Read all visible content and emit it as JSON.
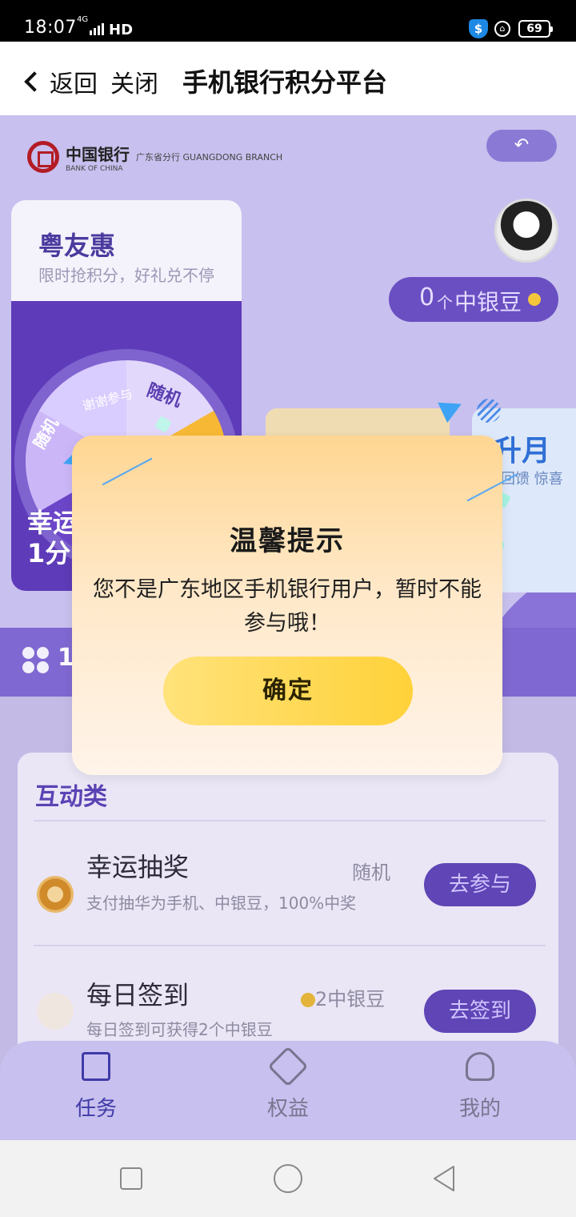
{
  "status_bar": {
    "time": "18:07",
    "network": "4G",
    "hd": "HD",
    "battery": "69"
  },
  "nav": {
    "back_label": "返回",
    "close_label": "关闭",
    "title": "手机银行积分平台"
  },
  "bank_logo": {
    "name_cn": "中国银行",
    "name_en": "BANK OF CHINA",
    "branch": "广东省分行 GUANGDONG BRANCH"
  },
  "promo_card": {
    "title": "粤友惠",
    "subtitle": "限时抢积分，好礼兑不停",
    "wheel_labels": [
      "随机",
      "谢谢参与",
      "随机"
    ],
    "bottom_text": "幸运\n1分"
  },
  "promo_card_right": {
    "title": "升月",
    "subtitle": "回馈 惊喜"
  },
  "beans": {
    "count": "0",
    "unit": "个",
    "label": "中银豆"
  },
  "strip": {
    "text": "1"
  },
  "tasks": {
    "section_title": "互动类",
    "items": [
      {
        "name": "幸运抽奖",
        "desc": "支付抽华为手机、中银豆，100%中奖",
        "reward": "随机",
        "button": "去参与"
      },
      {
        "name": "每日签到",
        "desc": "每日签到可获得2个中银豆",
        "reward": "2中银豆",
        "button": "去签到"
      }
    ]
  },
  "tabbar": {
    "tabs": [
      {
        "label": "任务",
        "active": true
      },
      {
        "label": "权益",
        "active": false
      },
      {
        "label": "我的",
        "active": false
      }
    ]
  },
  "modal": {
    "title": "温馨提示",
    "message": "您不是广东地区手机银行用户，暂时不能参与哦！",
    "confirm_label": "确定"
  },
  "colors": {
    "accent_purple": "#5b43b4",
    "modal_button": "#ffd23a",
    "active_tab": "#3f3aa8"
  }
}
